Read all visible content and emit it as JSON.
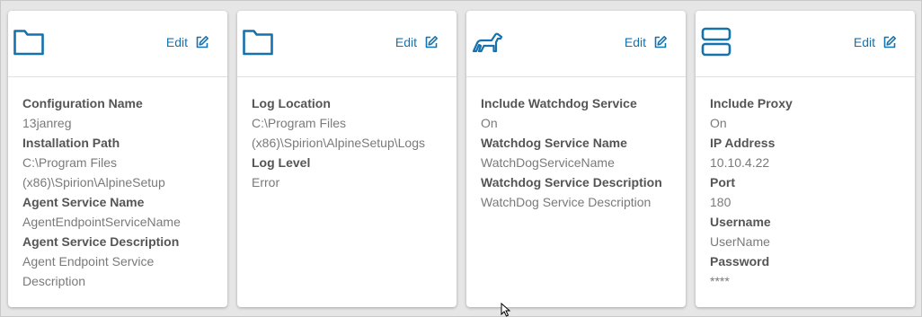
{
  "colors": {
    "accent": "#1672ad",
    "label": "#555555",
    "value": "#7a7a7a",
    "background": "#e6e6e6"
  },
  "cards": [
    {
      "icon": "folder-icon",
      "edit_label": "Edit",
      "fields": [
        {
          "label": "Configuration Name",
          "value_lines": [
            "13janreg"
          ]
        },
        {
          "label": "Installation Path",
          "value_lines": [
            "C:\\Program Files",
            "(x86)\\Spirion\\AlpineSetup"
          ]
        },
        {
          "label": "Agent Service Name",
          "value_lines": [
            "AgentEndpointServiceName"
          ]
        },
        {
          "label": "Agent Service Description",
          "value_lines": [
            "Agent Endpoint Service",
            "Description"
          ]
        }
      ]
    },
    {
      "icon": "folder-icon",
      "edit_label": "Edit",
      "fields": [
        {
          "label": "Log Location",
          "value_lines": [
            "C:\\Program Files",
            "(x86)\\Spirion\\AlpineSetup\\Logs"
          ]
        },
        {
          "label": "Log Level",
          "value_lines": [
            "Error"
          ]
        }
      ]
    },
    {
      "icon": "dog-icon",
      "edit_label": "Edit",
      "fields": [
        {
          "label": "Include Watchdog Service",
          "value_lines": [
            "On"
          ]
        },
        {
          "label": "Watchdog Service Name",
          "value_lines": [
            "WatchDogServiceName"
          ]
        },
        {
          "label": "Watchdog Service Description",
          "value_lines": [
            "WatchDog Service Description"
          ]
        }
      ]
    },
    {
      "icon": "server-icon",
      "edit_label": "Edit",
      "fields": [
        {
          "label": "Include Proxy",
          "value_lines": [
            "On"
          ]
        },
        {
          "label": "IP Address",
          "value_lines": [
            "10.10.4.22"
          ]
        },
        {
          "label": "Port",
          "value_lines": [
            "180"
          ]
        },
        {
          "label": "Username",
          "value_lines": [
            "UserName"
          ]
        },
        {
          "label": "Password",
          "value_lines": [
            "****"
          ]
        }
      ]
    }
  ]
}
